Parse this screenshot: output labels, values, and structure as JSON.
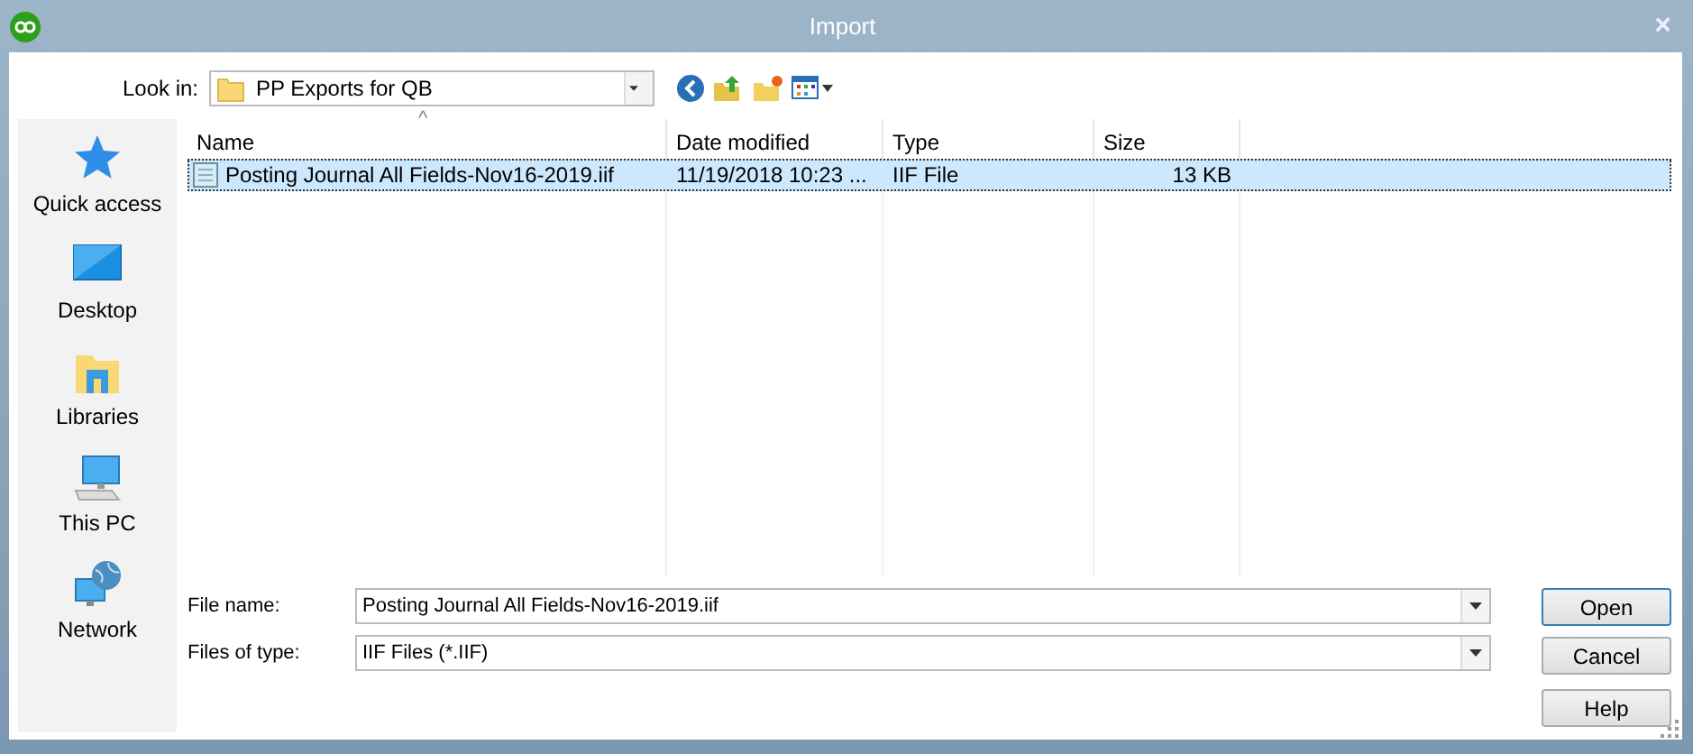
{
  "window": {
    "title": "Import",
    "close": "×"
  },
  "look_in": {
    "label": "Look in:",
    "value": "PP Exports for QB"
  },
  "places": [
    {
      "kind": "star",
      "label": "Quick access"
    },
    {
      "kind": "desktop",
      "label": "Desktop"
    },
    {
      "kind": "libraries",
      "label": "Libraries"
    },
    {
      "kind": "pc",
      "label": "This PC"
    },
    {
      "kind": "network",
      "label": "Network"
    }
  ],
  "table": {
    "sort_mark": "^",
    "columns": [
      "Name",
      "Date modified",
      "Type",
      "Size"
    ],
    "rows": [
      {
        "selected": true,
        "cells": [
          "Posting Journal All Fields-Nov16-2019.iif",
          "11/19/2018 10:23 ...",
          "IIF File",
          "13 KB"
        ]
      }
    ]
  },
  "file_name": {
    "label": "File name:",
    "value": "Posting Journal All Fields-Nov16-2019.iif"
  },
  "file_type": {
    "label": "Files of type:",
    "value": "IIF Files (*.IIF)"
  },
  "buttons": [
    "Open",
    "Cancel",
    "Help"
  ]
}
